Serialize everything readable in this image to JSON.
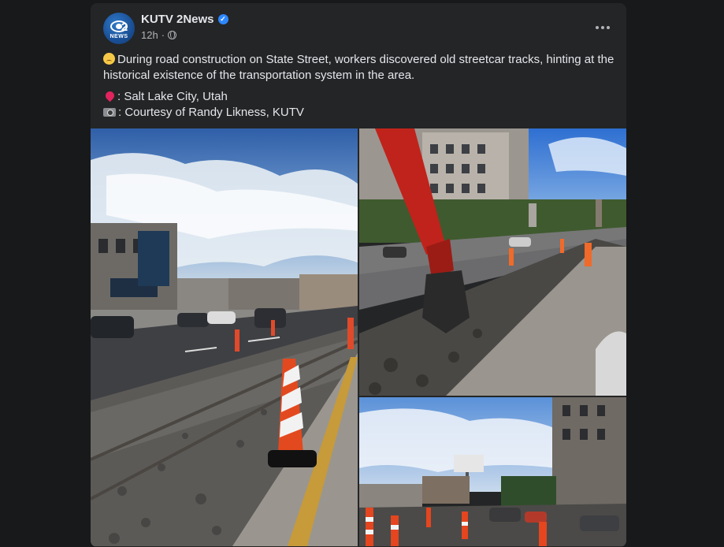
{
  "post": {
    "page_name": "KUTV 2News",
    "avatar_label": "2",
    "avatar_sub": "NEWS",
    "time": "12h",
    "separator": "·",
    "text_main": "During road construction on State Street, workers discovered old streetcar tracks, hinting at the historical existence of the transportation system in the area.",
    "location": ": Salt Lake City, Utah",
    "credit": ": Courtesy of Randy Likness, KUTV"
  },
  "icons": {
    "verified": "verified-badge-icon",
    "privacy": "globe-icon",
    "more": "more-options-icon"
  },
  "colors": {
    "background": "#18191a",
    "card": "#242526",
    "accent": "#2d88ff",
    "text": "#e4e6eb",
    "secondary_text": "#b0b3b8"
  }
}
